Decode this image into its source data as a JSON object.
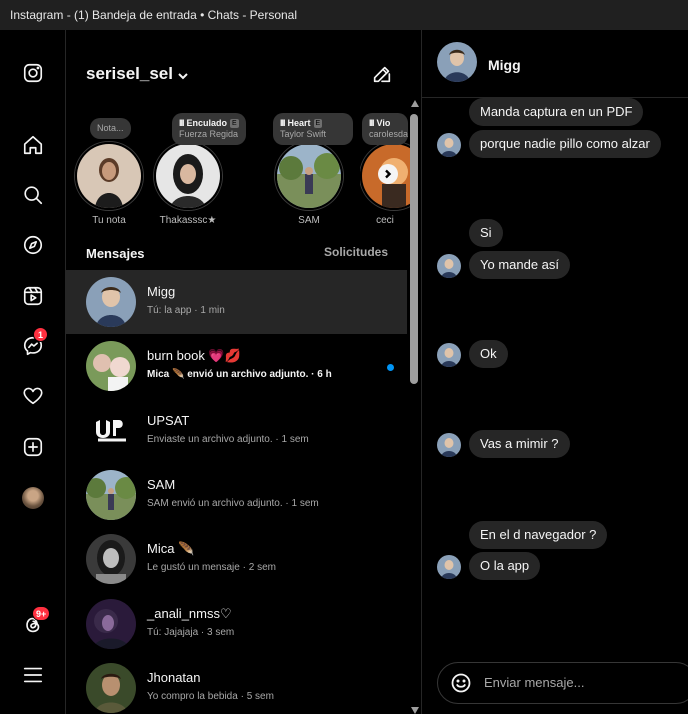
{
  "window": {
    "title": "Instagram - (1) Bandeja de entrada • Chats - Personal"
  },
  "sidebar": {
    "items": [
      {
        "name": "instagram-logo-icon"
      },
      {
        "name": "home-icon"
      },
      {
        "name": "search-icon"
      },
      {
        "name": "explore-icon"
      },
      {
        "name": "reels-icon"
      },
      {
        "name": "messenger-icon",
        "badge": "1"
      },
      {
        "name": "heart-icon"
      },
      {
        "name": "create-icon"
      },
      {
        "name": "profile-avatar"
      },
      {
        "name": "threads-icon",
        "badge": "9+"
      },
      {
        "name": "menu-icon"
      }
    ]
  },
  "inbox": {
    "username": "serisel_sel",
    "notes": [
      {
        "bubble_text": "Nota...",
        "name": "Tu nota"
      },
      {
        "bubble_title": "Enculado",
        "bubble_sub": "Fuerza Regida",
        "name": "Thakasssc★"
      },
      {
        "bubble_title": "Heart",
        "bubble_sub": "Taylor Swift",
        "name": "SAM"
      },
      {
        "bubble_title": "Vio",
        "bubble_sub": "carolesda",
        "name": "ceci"
      }
    ],
    "section_title": "Mensajes",
    "requests_label": "Solicitudes",
    "conversations": [
      {
        "name": "Migg",
        "preview": "Tú: la app · 1 min",
        "active": true,
        "unread": false
      },
      {
        "name": "burn book 💗💋",
        "preview": "Mica 🪶 envió un archivo adjunto. · 6 h",
        "active": false,
        "unread": true
      },
      {
        "name": "UPSAT",
        "preview": "Enviaste un archivo adjunto. · 1 sem",
        "active": false,
        "unread": false
      },
      {
        "name": "SAM",
        "preview": "SAM envió un archivo adjunto. · 1 sem",
        "active": false,
        "unread": false
      },
      {
        "name": "Mica 🪶",
        "preview": "Le gustó un mensaje · 2 sem",
        "active": false,
        "unread": false
      },
      {
        "name": "_anali_nmss♡",
        "preview": "Tú: Jajajaja · 3 sem",
        "active": false,
        "unread": false
      },
      {
        "name": "Jhonatan",
        "preview": "Yo compro la bebida · 5 sem",
        "active": false,
        "unread": false
      }
    ]
  },
  "chat": {
    "contact_name": "Migg",
    "messages": [
      "Manda captura en un PDF",
      "porque nadie pillo como alzar",
      "Si",
      "Yo mande así",
      "Ok",
      "Vas a mimir ?",
      "En el d navegador ?",
      "O la app"
    ],
    "composer_placeholder": "Enviar mensaje..."
  },
  "colors": {
    "background": "#000000",
    "bubble": "#262626",
    "unread": "#0095f6",
    "badge": "#ff3040",
    "active_row": "#262626"
  }
}
